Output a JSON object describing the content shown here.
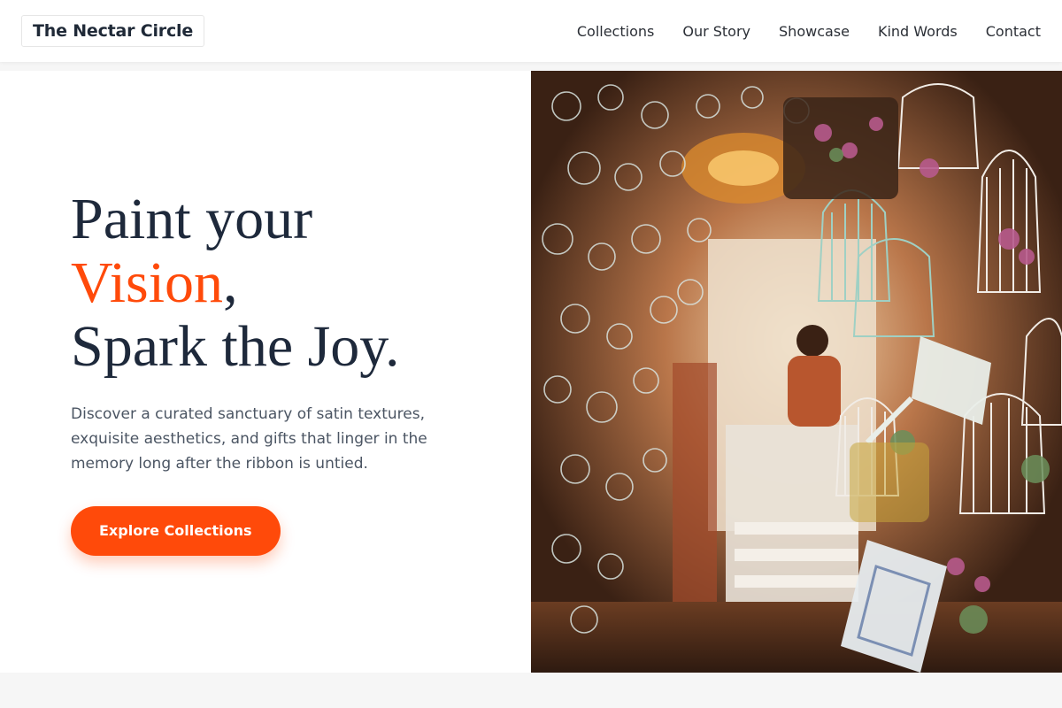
{
  "nav": {
    "logo": "The Nectar Circle",
    "links": [
      "Collections",
      "Our Story",
      "Showcase",
      "Kind Words",
      "Contact"
    ]
  },
  "hero": {
    "title_line1": "Paint your",
    "title_accent": "Vision",
    "title_comma": ",",
    "title_line3": "Spark the Joy.",
    "description": "Discover a curated sanctuary of satin textures, exquisite aesthetics, and gifts that linger in the memory long after the ribbon is untied.",
    "cta_label": "Explore Collections",
    "image_alt": "Shop interior filled with hanging decorative birdcages and flowers"
  },
  "colors": {
    "accent": "#ff4a0a",
    "heading": "#1e293b",
    "body_text": "#4b5563"
  }
}
